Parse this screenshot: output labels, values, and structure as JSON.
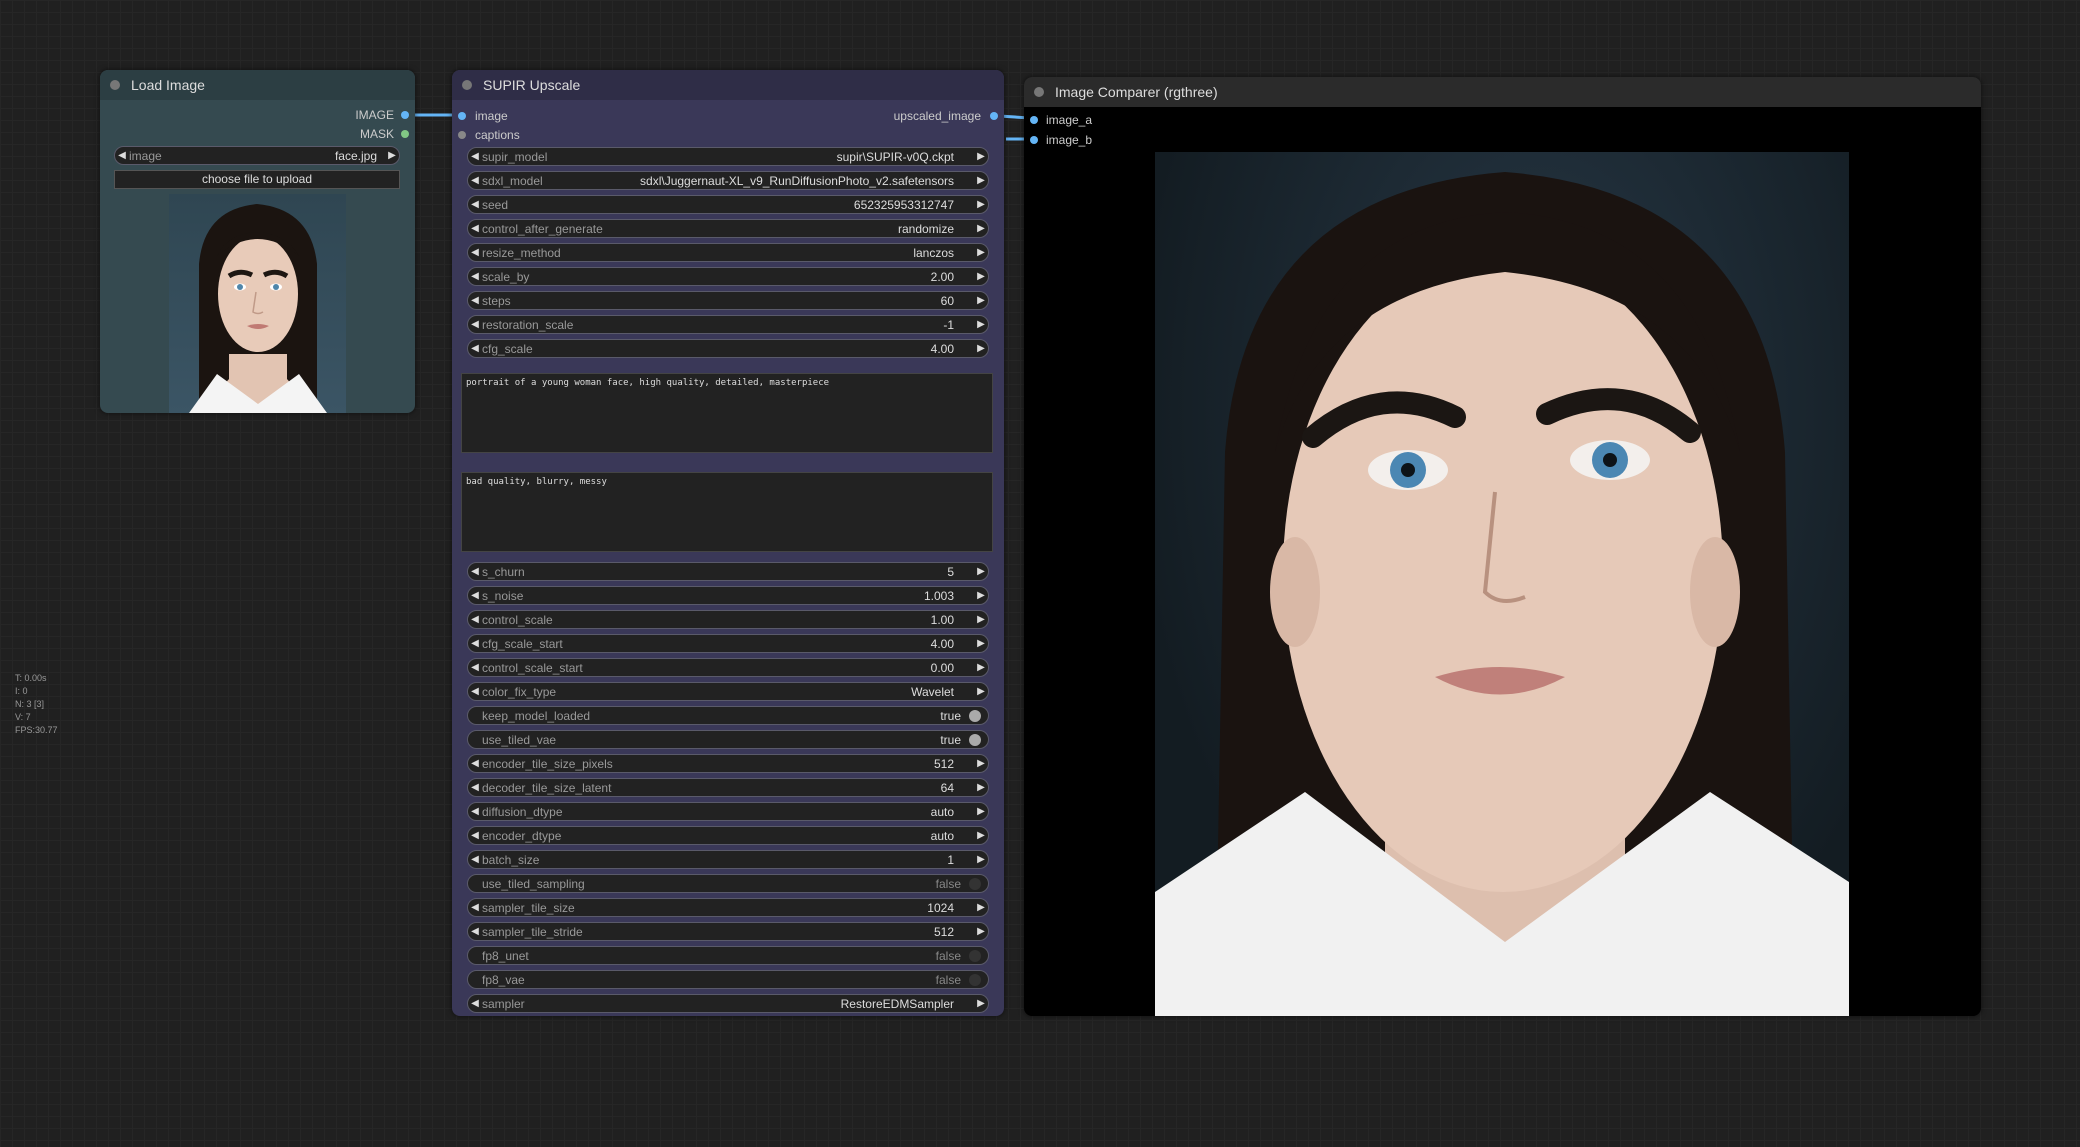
{
  "stats": {
    "lines": [
      "T: 0.00s",
      "I: 0",
      "N: 3 [3]",
      "V: 7",
      "FPS:30.77"
    ]
  },
  "load_image": {
    "title": "Load Image",
    "outputs": [
      {
        "label": "IMAGE",
        "color": "#64b5f6"
      },
      {
        "label": "MASK",
        "color": "#81c784"
      }
    ],
    "image_widget": {
      "label": "image",
      "value": "face.jpg"
    },
    "upload_button": "choose file to upload"
  },
  "supir": {
    "title": "SUPIR Upscale",
    "inputs": [
      "image",
      "captions"
    ],
    "output": "upscaled_image",
    "widgets_a": [
      {
        "label": "supir_model",
        "value": "supir\\SUPIR-v0Q.ckpt"
      },
      {
        "label": "sdxl_model",
        "value": "sdxl\\Juggernaut-XL_v9_RunDiffusionPhoto_v2.safetensors"
      },
      {
        "label": "seed",
        "value": "652325953312747"
      },
      {
        "label": "control_after_generate",
        "value": "randomize"
      },
      {
        "label": "resize_method",
        "value": "lanczos"
      },
      {
        "label": "scale_by",
        "value": "2.00"
      },
      {
        "label": "steps",
        "value": "60"
      },
      {
        "label": "restoration_scale",
        "value": "-1"
      },
      {
        "label": "cfg_scale",
        "value": "4.00"
      }
    ],
    "positive_prompt": "portrait of a young woman face, high quality, detailed, masterpiece",
    "negative_prompt": "bad quality, blurry, messy",
    "widgets_b": [
      {
        "label": "s_churn",
        "value": "5",
        "kind": "combo"
      },
      {
        "label": "s_noise",
        "value": "1.003",
        "kind": "combo"
      },
      {
        "label": "control_scale",
        "value": "1.00",
        "kind": "combo"
      },
      {
        "label": "cfg_scale_start",
        "value": "4.00",
        "kind": "combo"
      },
      {
        "label": "control_scale_start",
        "value": "0.00",
        "kind": "combo"
      },
      {
        "label": "color_fix_type",
        "value": "Wavelet",
        "kind": "combo"
      },
      {
        "label": "keep_model_loaded",
        "value": "true",
        "kind": "toggle",
        "on": true
      },
      {
        "label": "use_tiled_vae",
        "value": "true",
        "kind": "toggle",
        "on": true
      },
      {
        "label": "encoder_tile_size_pixels",
        "value": "512",
        "kind": "combo"
      },
      {
        "label": "decoder_tile_size_latent",
        "value": "64",
        "kind": "combo"
      },
      {
        "label": "diffusion_dtype",
        "value": "auto",
        "kind": "combo"
      },
      {
        "label": "encoder_dtype",
        "value": "auto",
        "kind": "combo"
      },
      {
        "label": "batch_size",
        "value": "1",
        "kind": "combo"
      },
      {
        "label": "use_tiled_sampling",
        "value": "false",
        "kind": "toggle",
        "on": false
      },
      {
        "label": "sampler_tile_size",
        "value": "1024",
        "kind": "combo"
      },
      {
        "label": "sampler_tile_stride",
        "value": "512",
        "kind": "combo"
      },
      {
        "label": "fp8_unet",
        "value": "false",
        "kind": "toggle",
        "on": false
      },
      {
        "label": "fp8_vae",
        "value": "false",
        "kind": "toggle",
        "on": false
      },
      {
        "label": "sampler",
        "value": "RestoreEDMSampler",
        "kind": "combo"
      }
    ]
  },
  "comparer": {
    "title": "Image Comparer (rgthree)",
    "inputs": [
      "image_a",
      "image_b"
    ]
  },
  "colors": {
    "load_node_bg": "#354a50",
    "load_title_bg": "#2c3e43",
    "supir_node_bg": "#3a3858",
    "supir_title_bg": "#2f2d47",
    "comparer_node_bg": "#2b2b2b",
    "link": "#64b5f6"
  }
}
